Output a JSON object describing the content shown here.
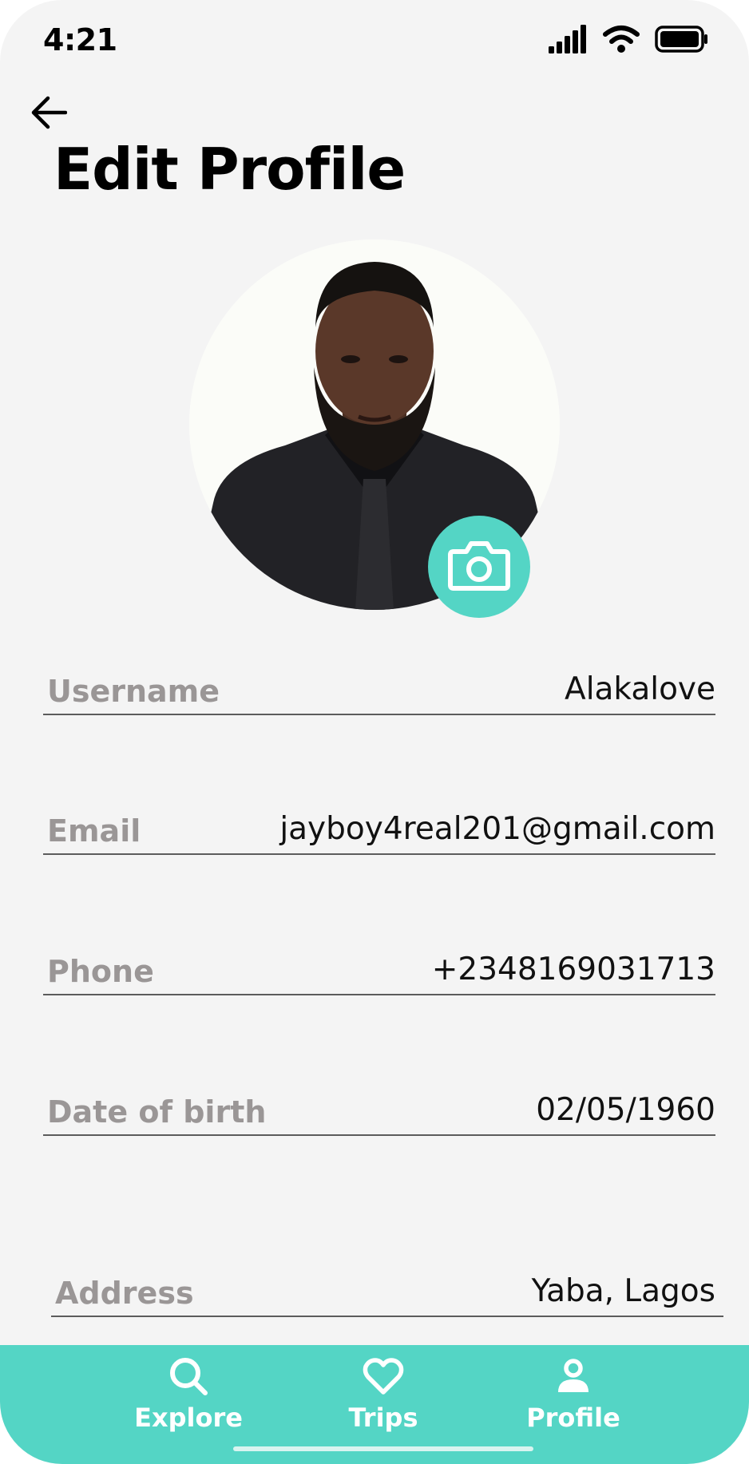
{
  "status_bar": {
    "time": "4:21",
    "icons": [
      "cellular-signal-icon",
      "wifi-icon",
      "battery-icon"
    ]
  },
  "header": {
    "back_icon": "arrow-left-icon",
    "title": "Edit Profile"
  },
  "avatar": {
    "edit_icon": "camera-icon"
  },
  "fields": [
    {
      "label": "Username",
      "value": "Alakalove"
    },
    {
      "label": "Email",
      "value": "jayboy4real201@gmail.com"
    },
    {
      "label": "Phone",
      "value": "+2348169031713"
    },
    {
      "label": "Date of birth",
      "value": "02/05/1960"
    },
    {
      "label": "Address",
      "value": "Yaba, Lagos"
    }
  ],
  "bottom_nav": {
    "items": [
      {
        "label": "Explore",
        "icon": "search-icon"
      },
      {
        "label": "Trips",
        "icon": "heart-icon"
      },
      {
        "label": "Profile",
        "icon": "person-icon"
      }
    ]
  },
  "colors": {
    "accent": "#54d5c5",
    "background": "#f4f4f4",
    "label": "#9a9696"
  }
}
